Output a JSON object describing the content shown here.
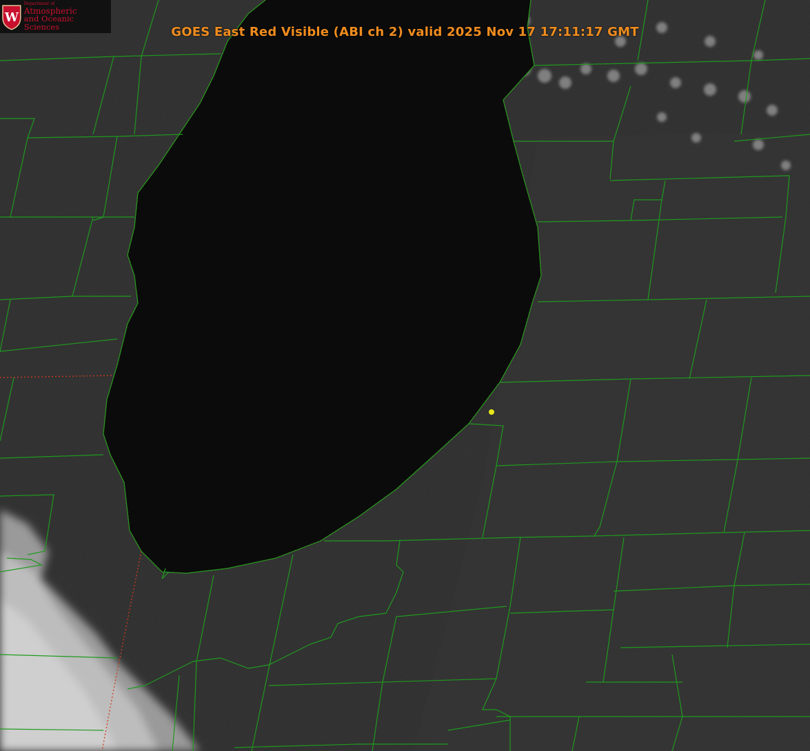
{
  "title": "GOES East Red Visible (ABI ch 2) valid 2025 Nov 17 17:11:17 GMT",
  "logo": {
    "department": "Department of",
    "line1": "Atmospheric",
    "line2": "and Oceanic Sciences",
    "crest_letter": "W"
  },
  "colors": {
    "title": "#f08c1e",
    "boundary": "#1f9a1f",
    "state_line": "#d23a1a",
    "lake": "#0b0b0b",
    "marker": "#e6e619",
    "logo_red": "#c8102e"
  },
  "icons": [
    "uw-crest-icon",
    "location-marker-icon"
  ]
}
